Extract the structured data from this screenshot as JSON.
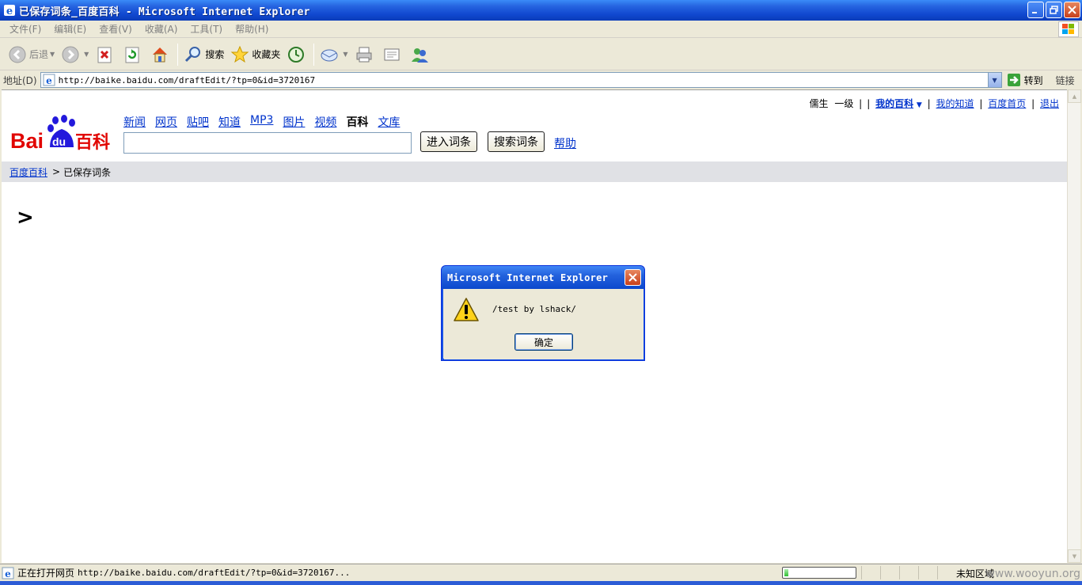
{
  "window": {
    "title": "已保存词条_百度百科 - Microsoft Internet Explorer"
  },
  "menu": {
    "items": [
      "文件(F)",
      "编辑(E)",
      "查看(V)",
      "收藏(A)",
      "工具(T)",
      "帮助(H)"
    ]
  },
  "toolbar": {
    "back_label": "后退",
    "search_label": "搜索",
    "favorites_label": "收藏夹"
  },
  "address": {
    "label": "地址(D)",
    "url": "http://baike.baidu.com/draftEdit/?tp=0&id=3720167",
    "go_label": "转到",
    "links_label": "链接"
  },
  "page": {
    "user": {
      "name": "儒生",
      "level": "一级",
      "sep1": "|",
      "sep2": "|",
      "my_baike": "我的百科",
      "sep3": "|",
      "my_zhidao": "我的知道",
      "sep4": "|",
      "baidu_home": "百度首页",
      "sep5": "|",
      "logout": "退出"
    },
    "logo": {
      "text_a": "Bai",
      "text_b": "du",
      "text_c": "百科"
    },
    "nav": {
      "news": "新闻",
      "web": "网页",
      "tieba": "贴吧",
      "zhidao": "知道",
      "mp3": "MP3",
      "images": "图片",
      "video": "视频",
      "baike": "百科",
      "wenku": "文库"
    },
    "search": {
      "enter_button": "进入词条",
      "search_button": "搜索词条",
      "help": "帮助"
    },
    "breadcrumb": {
      "home": "百度百科",
      "sep": ">",
      "current": "已保存词条"
    },
    "gt_mark": ">"
  },
  "dialog": {
    "title": "Microsoft Internet Explorer",
    "message": "/test by lshack/",
    "ok": "确定"
  },
  "status": {
    "text": "正在打开网页",
    "url": "http://baike.baidu.com/draftEdit/?tp=0&id=3720167...",
    "zone": "未知区域",
    "progress": 0.06
  },
  "watermark": "www.wooyun.org",
  "colors": {
    "link": "#0033cc",
    "title_blue": "#0a3cb8",
    "baidu_red": "#e10602",
    "baidu_blue": "#2319dc"
  }
}
